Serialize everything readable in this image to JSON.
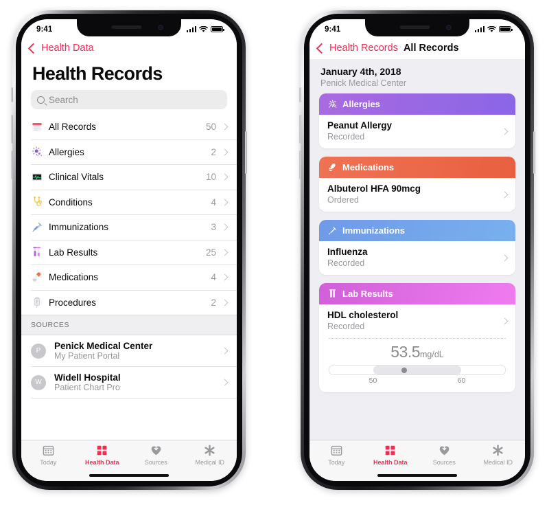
{
  "meta": {
    "app": "Health",
    "platform": "iOS"
  },
  "status_bar": {
    "time": "9:41",
    "signal_icon": "cellular-signal-icon",
    "wifi_icon": "wifi-icon",
    "battery_icon": "battery-icon"
  },
  "phone_left": {
    "nav": {
      "back_label": "Health Data",
      "back_icon": "chevron-left-icon"
    },
    "title": "Health Records",
    "search": {
      "placeholder": "Search",
      "icon": "search-icon",
      "value": ""
    },
    "categories": [
      {
        "label": "All Records",
        "count": "50",
        "icon": "all-records-icon"
      },
      {
        "label": "Allergies",
        "count": "2",
        "icon": "allergies-icon"
      },
      {
        "label": "Clinical Vitals",
        "count": "10",
        "icon": "clinical-vitals-icon"
      },
      {
        "label": "Conditions",
        "count": "4",
        "icon": "conditions-icon"
      },
      {
        "label": "Immunizations",
        "count": "3",
        "icon": "immunizations-icon"
      },
      {
        "label": "Lab Results",
        "count": "25",
        "icon": "lab-results-icon"
      },
      {
        "label": "Medications",
        "count": "4",
        "icon": "medications-icon"
      },
      {
        "label": "Procedures",
        "count": "2",
        "icon": "procedures-icon"
      }
    ],
    "sources_header": "SOURCES",
    "sources": [
      {
        "initial": "P",
        "name": "Penick Medical Center",
        "subtitle": "My Patient Portal"
      },
      {
        "initial": "W",
        "name": "Widell Hospital",
        "subtitle": "Patient Chart Pro"
      }
    ]
  },
  "phone_right": {
    "nav": {
      "back_label": "Health Records",
      "back_icon": "chevron-left-icon",
      "title": "All Records"
    },
    "record_date": "January 4th, 2018",
    "record_source": "Penick Medical Center",
    "cards": [
      {
        "category": "Allergies",
        "icon": "allergies-icon",
        "color_start": "#a96ae0",
        "color_end": "#8a66e6",
        "item_title": "Peanut Allergy",
        "item_status": "Recorded"
      },
      {
        "category": "Medications",
        "icon": "medications-icon",
        "color_start": "#ef7254",
        "color_end": "#e8603f",
        "item_title": "Albuterol HFA 90mcg",
        "item_status": "Ordered"
      },
      {
        "category": "Immunizations",
        "icon": "immunizations-icon",
        "color_start": "#6f9ae8",
        "color_end": "#78b0ef",
        "item_title": "Influenza",
        "item_status": "Recorded"
      },
      {
        "category": "Lab Results",
        "icon": "lab-results-icon",
        "color_start": "#d060d8",
        "color_end": "#f07bf0",
        "item_title": "HDL cholesterol",
        "item_status": "Recorded",
        "measurement": {
          "value": "53.5",
          "unit": "mg/dL",
          "range_low_label": "50",
          "range_high_label": "60",
          "range_low": 50,
          "range_high": 60,
          "scale_min": 45,
          "scale_max": 65
        }
      }
    ]
  },
  "tab_bar": {
    "accent_color": "#fa2b50",
    "inactive_color": "#9a9a9e",
    "tabs": [
      {
        "label": "Today",
        "icon": "today-calendar-icon",
        "active": false
      },
      {
        "label": "Health Data",
        "icon": "health-data-grid-icon",
        "active": true
      },
      {
        "label": "Sources",
        "icon": "sources-heart-icon",
        "active": false
      },
      {
        "label": "Medical ID",
        "icon": "medical-id-asterisk-icon",
        "active": false
      }
    ]
  }
}
